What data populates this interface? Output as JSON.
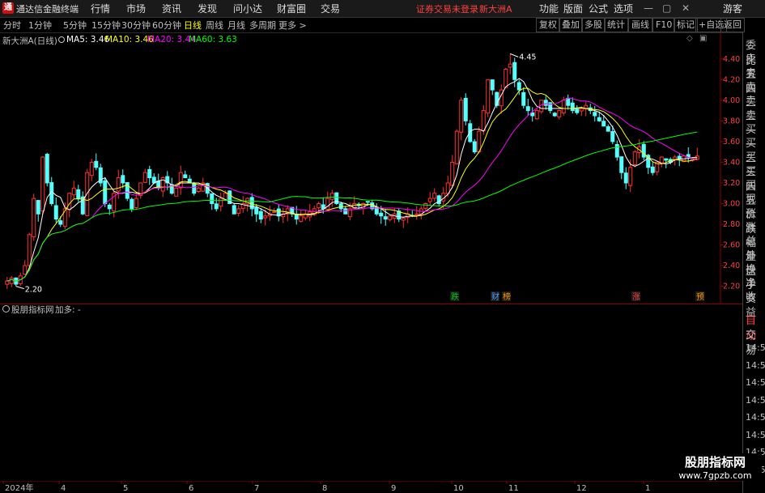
{
  "titlebar": {
    "app_name": "通达信金融终端",
    "menus": [
      "行情",
      "市场",
      "资讯",
      "发现",
      "问小达",
      "财富圈",
      "交易"
    ],
    "warning": "证券交易未登录",
    "stock_title": "新大洲A",
    "right_menus": [
      "功能",
      "版面",
      "公式",
      "选项"
    ],
    "guest": "游客"
  },
  "toolbar": {
    "periods": [
      "分时",
      "1分钟",
      "5分钟",
      "15分钟",
      "30分钟",
      "60分钟",
      "日线",
      "周线",
      "月线",
      "多周期",
      "更多 >"
    ],
    "active_period": "日线",
    "buttons": [
      "复权",
      "叠加",
      "多股",
      "统计",
      "画线",
      "F10",
      "标记",
      "+自选",
      "返回"
    ]
  },
  "chart_header": {
    "stock": "新大洲A(日线)",
    "ma5": "MA5: 3.46",
    "ma10": "MA10: 3.46",
    "ma20": "MA20: 3.44",
    "ma60": "MA60: 3.63",
    "colors": {
      "ma5": "#ffffff",
      "ma10": "#ffff00",
      "ma20": "#ff00ff",
      "ma60": "#00ff00"
    }
  },
  "sub_header": {
    "indicator": "股朋指标网",
    "value": "加多: -"
  },
  "annotations": {
    "high": "4.45",
    "low": "2.20",
    "events": [
      "跌",
      "财",
      "榜",
      "涨",
      "预"
    ]
  },
  "side_panel": {
    "labels": [
      "委比",
      "卖五",
      "卖四",
      "卖三",
      "卖二",
      "卖一",
      "买一",
      "买二",
      "买三",
      "买四",
      "买五",
      "现价",
      "涨跌",
      "涨幅",
      "总量",
      "外盘",
      "换手",
      "净资",
      "收益"
    ],
    "bottom_tabs": [
      "自动",
      "交易"
    ],
    "times": [
      "14:56",
      "14:56",
      "14:56",
      "14:56",
      "14:56",
      "14:56",
      "14:56",
      "14:56"
    ]
  },
  "watermark": {
    "title": "股朋指标网",
    "url": "www.7gpzb.com"
  },
  "chart_data": {
    "type": "candlestick",
    "y_ticks": [
      "4.40",
      "4.20",
      "4.00",
      "3.80",
      "3.60",
      "3.40",
      "3.20",
      "3.00",
      "2.80",
      "2.60",
      "2.40",
      "2.20"
    ],
    "ylim": [
      2.15,
      4.5
    ],
    "x_ticks": [
      "2024年",
      "4",
      "5",
      "6",
      "7",
      "8",
      "9",
      "10",
      "11",
      "12",
      "1"
    ],
    "close": [
      2.25,
      2.28,
      2.22,
      2.3,
      2.4,
      2.7,
      3.05,
      2.9,
      3.45,
      3.2,
      3.0,
      2.85,
      2.8,
      2.95,
      3.1,
      3.15,
      3.05,
      2.9,
      3.3,
      3.4,
      3.35,
      3.2,
      3.0,
      2.95,
      3.1,
      3.25,
      3.2,
      3.05,
      2.95,
      3.05,
      3.2,
      3.3,
      3.25,
      3.2,
      3.15,
      3.25,
      3.2,
      3.1,
      3.15,
      3.3,
      3.25,
      3.2,
      3.1,
      3.15,
      3.2,
      3.1,
      3.0,
      2.95,
      3.05,
      3.1,
      3.0,
      2.9,
      2.95,
      3.0,
      3.05,
      2.95,
      2.9,
      2.85,
      2.88,
      2.9,
      2.92,
      2.88,
      2.9,
      2.95,
      2.9,
      2.85,
      2.88,
      2.9,
      2.92,
      2.95,
      3.0,
      2.95,
      3.05,
      3.1,
      3.0,
      2.95,
      2.9,
      2.95,
      3.0,
      2.98,
      3.0,
      3.02,
      2.95,
      2.9,
      2.88,
      2.85,
      2.88,
      2.9,
      2.85,
      2.86,
      2.9,
      2.88,
      2.9,
      2.95,
      3.0,
      3.05,
      3.1,
      3.0,
      3.1,
      3.2,
      3.4,
      3.7,
      4.0,
      3.8,
      3.6,
      3.5,
      3.7,
      3.9,
      4.2,
      4.1,
      3.95,
      4.1,
      4.3,
      4.35,
      4.2,
      4.1,
      3.95,
      3.9,
      3.85,
      3.9,
      4.0,
      3.95,
      3.9,
      3.85,
      3.9,
      4.0,
      3.95,
      3.9,
      3.88,
      3.92,
      3.95,
      3.9,
      3.85,
      3.8,
      3.75,
      3.7,
      3.6,
      3.45,
      3.3,
      3.2,
      3.35,
      3.5,
      3.55,
      3.45,
      3.35,
      3.3,
      3.4,
      3.45,
      3.42,
      3.4,
      3.45,
      3.43,
      3.46,
      3.45,
      3.44,
      3.46
    ]
  }
}
